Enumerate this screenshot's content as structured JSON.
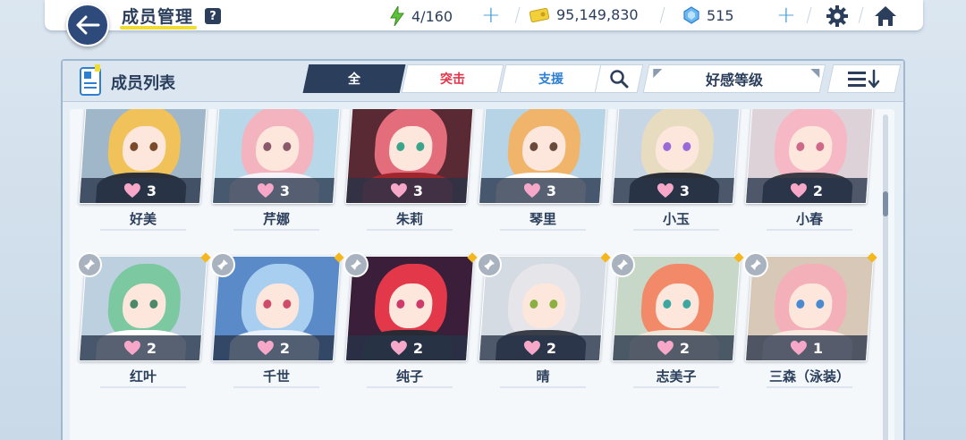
{
  "header": {
    "title": "成员管理",
    "help_label": "?",
    "stamina": "4/160",
    "credits": "95,149,830",
    "gems": "515"
  },
  "panel": {
    "title": "成员列表",
    "tabs": [
      {
        "label": "全"
      },
      {
        "label": "突击"
      },
      {
        "label": "支援"
      }
    ],
    "sort_label": "好感等级"
  },
  "colors": {
    "navy": "#2b3e5c",
    "accent_yellow": "#f0dc32",
    "striker_red": "#e0344a",
    "special_blue": "#2f7fd0",
    "heart_pink": "#f7a8c8"
  },
  "students": [
    {
      "name": "好美",
      "affection": "3",
      "hair": "#f2c25a",
      "eye": "#7a4a2a",
      "outfit": "#2a2f3a",
      "bg": "#9fb7c8"
    },
    {
      "name": "芹娜",
      "affection": "3",
      "hair": "#f3b4c0",
      "eye": "#8a5a6a",
      "outfit": "#f4f4f8",
      "bg": "#b8d8ea"
    },
    {
      "name": "朱莉",
      "affection": "3",
      "hair": "#e36d7a",
      "eye": "#3aa58a",
      "outfit": "#a0262e",
      "bg": "#5a2a34"
    },
    {
      "name": "琴里",
      "affection": "3",
      "hair": "#f0b46a",
      "eye": "#6a4a3a",
      "outfit": "#ffffff",
      "bg": "#b7d3e6"
    },
    {
      "name": "小玉",
      "affection": "3",
      "hair": "#e8dcc0",
      "eye": "#9a6ad8",
      "outfit": "#2b2e36",
      "bg": "#c6d6e4"
    },
    {
      "name": "小春",
      "affection": "2",
      "hair": "#f5b8c4",
      "eye": "#d0688a",
      "outfit": "#3a3a44",
      "bg": "#dcd2d8"
    },
    {
      "name": "红叶",
      "affection": "2",
      "hair": "#7cc8a0",
      "eye": "#4a8a6a",
      "outfit": "#ffffff",
      "bg": "#bcd0e0"
    },
    {
      "name": "千世",
      "affection": "2",
      "hair": "#a8cff0",
      "eye": "#d04a6a",
      "outfit": "#e8f0fa",
      "bg": "#5a8ac8"
    },
    {
      "name": "纯子",
      "affection": "2",
      "hair": "#e2384a",
      "eye": "#d03a6a",
      "outfit": "#2a2a34",
      "bg": "#3a1e3a"
    },
    {
      "name": "晴",
      "affection": "2",
      "hair": "#e6e6ea",
      "eye": "#8ab040",
      "outfit": "#3a3e48",
      "bg": "#d4dbe2"
    },
    {
      "name": "志美子",
      "affection": "2",
      "hair": "#f28a6a",
      "eye": "#3aa8a0",
      "outfit": "#f0e6d8",
      "bg": "#c8d8c8"
    },
    {
      "name": "三森（泳装）",
      "affection": "1",
      "hair": "#f4b0b8",
      "eye": "#4a8ad0",
      "outfit": "#f8e8e0",
      "bg": "#d8c8b8"
    }
  ]
}
